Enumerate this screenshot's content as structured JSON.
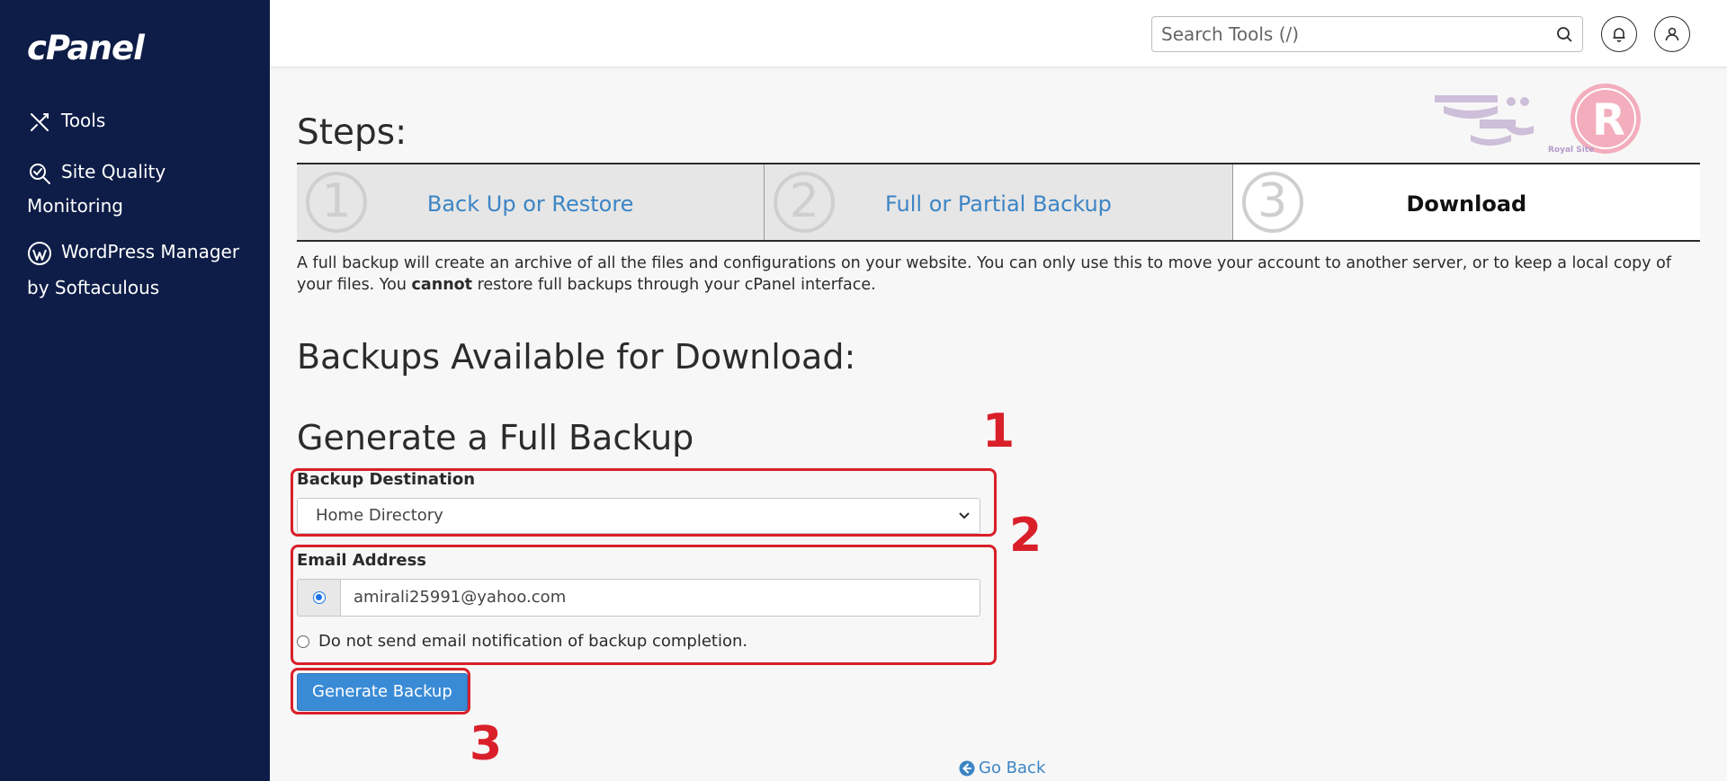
{
  "sidebar": {
    "logo": "cPanel",
    "items": [
      {
        "label": "Tools",
        "icon": "tools-icon"
      },
      {
        "label_line1": "Site Quality",
        "label_line2": "Monitoring",
        "icon": "site-quality-icon"
      },
      {
        "label_line1": "WordPress Manager",
        "label_line2": "by Softaculous",
        "icon": "wordpress-icon"
      }
    ]
  },
  "header": {
    "search_placeholder": "Search Tools (/)"
  },
  "steps": {
    "title": "Steps:",
    "items": [
      {
        "number": "1",
        "label": "Back Up or Restore",
        "active": false
      },
      {
        "number": "2",
        "label": "Full or Partial Backup",
        "active": false
      },
      {
        "number": "3",
        "label": "Download",
        "active": true
      }
    ]
  },
  "description": {
    "part1": "A full backup will create an archive of all the files and configurations on your website. You can only use this to move your account to another server, or to keep a local copy of your files. You ",
    "bold": "cannot",
    "part2": " restore full backups through your cPanel interface."
  },
  "headings": {
    "available": "Backups Available for Download:",
    "generate": "Generate a Full Backup"
  },
  "form": {
    "destination_label": "Backup Destination",
    "destination_value": "Home Directory",
    "email_label": "Email Address",
    "email_value": "amirali25991@yahoo.com",
    "no_email_label": "Do not send email notification of backup completion.",
    "generate_button": "Generate Backup",
    "go_back": "Go Back"
  },
  "annotations": {
    "n1": "1",
    "n2": "2",
    "n3": "3"
  },
  "watermark": {
    "text": "Royal Site"
  },
  "colors": {
    "sidebar_bg": "#0e1d47",
    "link": "#3c85c5",
    "button": "#3a8bd5",
    "annotation": "#d9202a"
  }
}
